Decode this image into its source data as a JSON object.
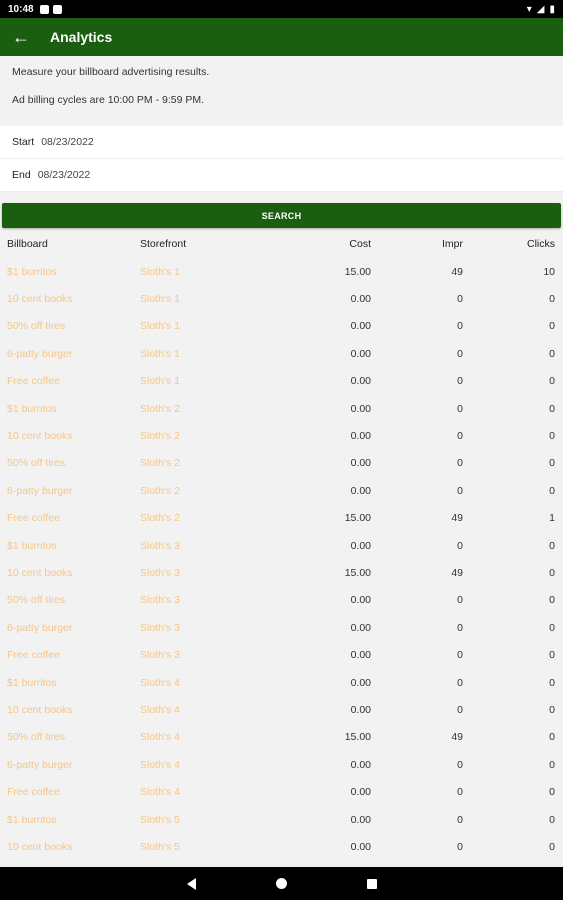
{
  "status": {
    "time": "10:48"
  },
  "app_bar": {
    "title": "Analytics"
  },
  "intro": {
    "line1": "Measure your billboard advertising results.",
    "line2": "Ad billing cycles are 10:00 PM - 9:59 PM."
  },
  "start": {
    "label": "Start",
    "value": "08/23/2022"
  },
  "end": {
    "label": "End",
    "value": "08/23/2022"
  },
  "search": {
    "label": "SEARCH"
  },
  "table": {
    "headers": [
      "Billboard",
      "Storefront",
      "Cost",
      "Impr",
      "Clicks"
    ],
    "rows": [
      [
        "$1 burritos",
        "Sloth's 1",
        "15.00",
        "49",
        "10"
      ],
      [
        "10 cent books",
        "Sloth's 1",
        "0.00",
        "0",
        "0"
      ],
      [
        "50% off tires",
        "Sloth's 1",
        "0.00",
        "0",
        "0"
      ],
      [
        "6-patty burger",
        "Sloth's 1",
        "0.00",
        "0",
        "0"
      ],
      [
        "Free coffee",
        "Sloth's 1",
        "0.00",
        "0",
        "0"
      ],
      [
        "$1 burritos",
        "Sloth's 2",
        "0.00",
        "0",
        "0"
      ],
      [
        "10 cent books",
        "Sloth's 2",
        "0.00",
        "0",
        "0"
      ],
      [
        "50% off tires",
        "Sloth's 2",
        "0.00",
        "0",
        "0"
      ],
      [
        "6-patty burger",
        "Sloth's 2",
        "0.00",
        "0",
        "0"
      ],
      [
        "Free coffee",
        "Sloth's 2",
        "15.00",
        "49",
        "1"
      ],
      [
        "$1 burritos",
        "Sloth's 3",
        "0.00",
        "0",
        "0"
      ],
      [
        "10 cent books",
        "Sloth's 3",
        "15.00",
        "49",
        "0"
      ],
      [
        "50% off tires",
        "Sloth's 3",
        "0.00",
        "0",
        "0"
      ],
      [
        "6-patty burger",
        "Sloth's 3",
        "0.00",
        "0",
        "0"
      ],
      [
        "Free coffee",
        "Sloth's 3",
        "0.00",
        "0",
        "0"
      ],
      [
        "$1 burritos",
        "Sloth's 4",
        "0.00",
        "0",
        "0"
      ],
      [
        "10 cent books",
        "Sloth's 4",
        "0.00",
        "0",
        "0"
      ],
      [
        "50% off tires",
        "Sloth's 4",
        "15.00",
        "49",
        "0"
      ],
      [
        "6-patty burger",
        "Sloth's 4",
        "0.00",
        "0",
        "0"
      ],
      [
        "Free coffee",
        "Sloth's 4",
        "0.00",
        "0",
        "0"
      ],
      [
        "$1 burritos",
        "Sloth's 5",
        "0.00",
        "0",
        "0"
      ],
      [
        "10 cent books",
        "Sloth's 5",
        "0.00",
        "0",
        "0"
      ]
    ]
  }
}
